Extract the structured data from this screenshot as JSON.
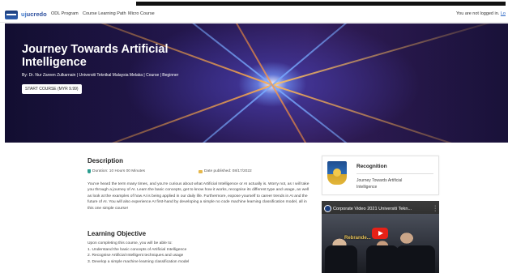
{
  "navbar": {
    "logo_text_a": "uj",
    "logo_text_b": "ucredo",
    "links": [
      "ODL Program",
      "Course Learning Path",
      "Micro Course"
    ],
    "login_text": "You are not logged in.",
    "login_link": "Lo"
  },
  "hero": {
    "title": "Journey Towards Artificial Intelligence",
    "byline": "By: Dr. Nur Zareen Zulkarnain | Universiti Teknikal Malaysia Melaka | Course | Beginner",
    "start_button": "START COURSE (MYR 9.99)"
  },
  "description": {
    "heading": "Description",
    "duration": "Duration: 10 Hours 00 Minutes",
    "date_published": "Date published: 08/17/2022",
    "body": "You've heard the term many times, and you're curious about what Artificial Intelligence or AI actually is. Worry not, as I will take you through a journey of AI. Learn the basic concepts, get to know how it works, recognise its different type and usage, as well as look at the examples of how AI is being applied in our daily life. Furthermore, expose yourself to career trends in AI and the future of AI. You will also experience AI first-hand by developing a simple no code machine learning classification model, all in this one simple course!"
  },
  "learning_objective": {
    "heading": "Learning Objective",
    "intro": "Upon completing this course, you will be able to:",
    "items": [
      "1. Understand the basic concepts of Artificial Intelligence",
      "2. Recognise Artificial Intelligent techniques and usage",
      "3. Develop a simple machine learning classification model"
    ]
  },
  "recognition": {
    "title": "Recognition",
    "subtitle": "Journey Towards Artificial Intelligence"
  },
  "video": {
    "title": "Corporate Video 2021 Universiti Tekn...",
    "overlay": "Rebrande..."
  },
  "colors": {
    "accent": "#2a66c4",
    "youtube_red": "#e62117",
    "duration_icon": "#2a9d8f",
    "calendar_icon": "#e6b84c"
  }
}
